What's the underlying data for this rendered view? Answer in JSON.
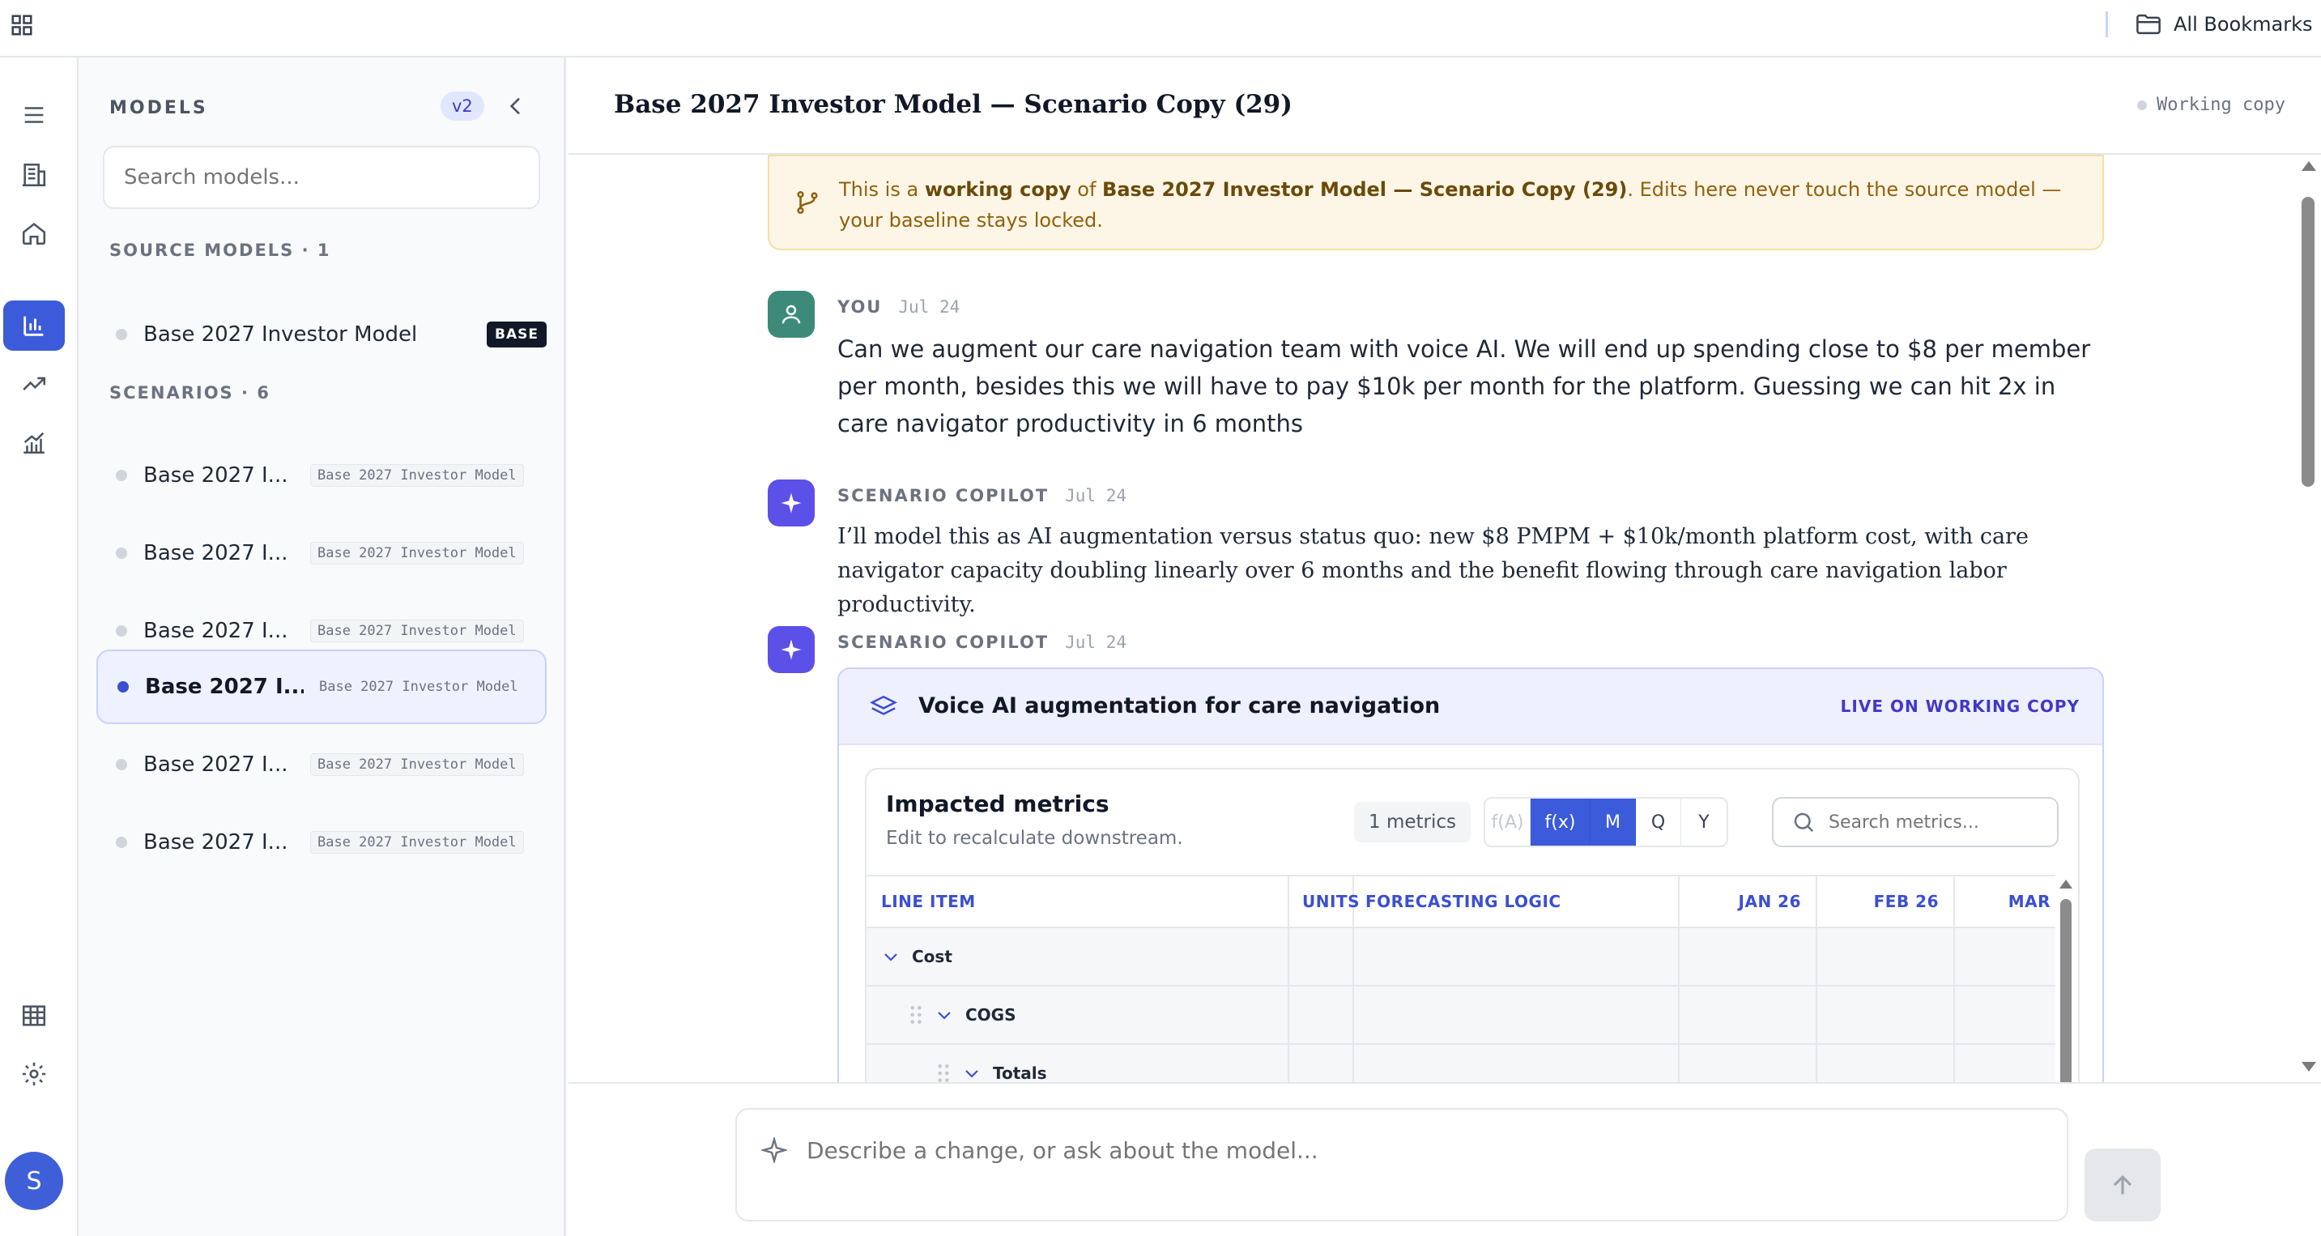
{
  "topbar": {
    "apps_icon": "apps-grid-icon",
    "bookmarks_label": "All Bookmarks",
    "bookmarks_icon": "folder-icon"
  },
  "rail": {
    "items": [
      {
        "name": "menu-icon"
      },
      {
        "name": "building-icon"
      },
      {
        "name": "home-icon"
      },
      {
        "name": "bar-chart-icon",
        "active": true
      },
      {
        "name": "trending-up-icon"
      },
      {
        "name": "line-chart-icon"
      },
      {
        "name": "table-icon"
      },
      {
        "name": "settings-icon"
      }
    ],
    "avatar_initial": "S",
    "accent": "#3b5bdb"
  },
  "sidebar": {
    "title": "MODELS",
    "version": "v2",
    "search_placeholder": "Search models...",
    "source_heading": "SOURCE MODELS · 1",
    "source_models": [
      {
        "name": "Base 2027 Investor Model",
        "badge": "BASE"
      }
    ],
    "scenario_heading": "SCENARIOS · 6",
    "scenarios": [
      {
        "name": "Base 2027 I...",
        "tag": "Base 2027 Investor Model",
        "selected": false
      },
      {
        "name": "Base 2027 I...",
        "tag": "Base 2027 Investor Model",
        "selected": false
      },
      {
        "name": "Base 2027 I...",
        "tag": "Base 2027 Investor Model",
        "selected": false
      },
      {
        "name": "Base 2027 I...",
        "tag": "Base 2027 Investor Model",
        "selected": true
      },
      {
        "name": "Base 2027 I...",
        "tag": "Base 2027 Investor Model",
        "selected": false
      },
      {
        "name": "Base 2027 I...",
        "tag": "Base 2027 Investor Model",
        "selected": false
      }
    ]
  },
  "header": {
    "title": "Base 2027 Investor Model — Scenario Copy (29)",
    "status": "Working copy"
  },
  "banner": {
    "prefix": "This is a ",
    "bold1": "working copy",
    "mid": " of ",
    "bold2": "Base 2027 Investor Model — Scenario Copy (29)",
    "suffix": ". Edits here never touch the source model — your baseline stays locked.",
    "colors": {
      "background": "#fdf6e7",
      "text": "#92600a"
    }
  },
  "messages": [
    {
      "author": "YOU",
      "date": "Jul 24",
      "text": "Can we augment our care navigation team with voice AI. We will end up spending close to $8 per member per month, besides this we will have to pay $10k per month for the platform. Guessing we can hit 2x in care navigator productivity in 6 months"
    },
    {
      "author": "SCENARIO COPILOT",
      "date": "Jul 24",
      "text": "I’ll model this as AI augmentation versus status quo: new $8 PMPM + $10k/month platform cost, with care navigator capacity doubling linearly over 6 months and the benefit flowing through care navigation labor productivity."
    },
    {
      "author": "SCENARIO COPILOT",
      "date": "Jul 24"
    }
  ],
  "card": {
    "title": "Voice AI augmentation for care navigation",
    "live_label": "LIVE ON WORKING COPY",
    "panel_title": "Impacted metrics",
    "panel_subtitle": "Edit to recalculate downstream.",
    "metrics_count": "1 metrics",
    "toggles": [
      {
        "label": "f(A)",
        "state": "disabled"
      },
      {
        "label": "f(x)",
        "state": "on"
      },
      {
        "label": "M",
        "state": "on"
      },
      {
        "label": "Q",
        "state": "off"
      },
      {
        "label": "Y",
        "state": "off"
      }
    ],
    "search_placeholder": "Search metrics...",
    "columns": [
      "LINE ITEM",
      "UNITS",
      "FORECASTING LOGIC",
      "JAN 26",
      "FEB 26",
      "MAR"
    ],
    "rows": [
      {
        "label": "Cost",
        "level": 0
      },
      {
        "label": "COGS",
        "level": 1
      },
      {
        "label": "Totals",
        "level": 2
      }
    ]
  },
  "composer": {
    "placeholder": "Describe a change, or ask about the model..."
  }
}
